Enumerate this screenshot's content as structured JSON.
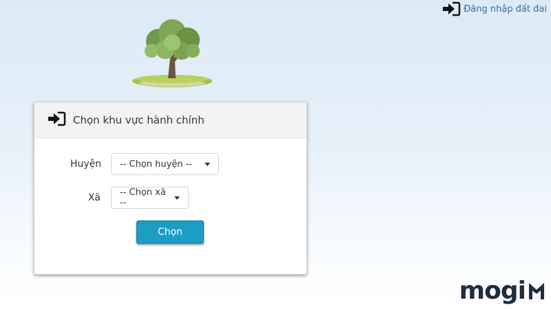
{
  "header": {
    "login_link_label": "Đăng nhập đất đai",
    "login_icon": "sign-in-icon"
  },
  "illustration": {
    "icon": "tree-icon"
  },
  "panel": {
    "title": "Chọn khu vực hành chính",
    "title_icon": "sign-in-icon",
    "district": {
      "label": "Huyện",
      "selected": "-- Chọn huyện --"
    },
    "commune": {
      "label": "Xã",
      "selected": "-- Chọn xã --"
    },
    "submit_label": "Chọn"
  },
  "brand": {
    "name": "mogi"
  },
  "colors": {
    "primary_button": "#1c9dc3",
    "link": "#3a6f9a",
    "brand": "#1f2d3d"
  }
}
